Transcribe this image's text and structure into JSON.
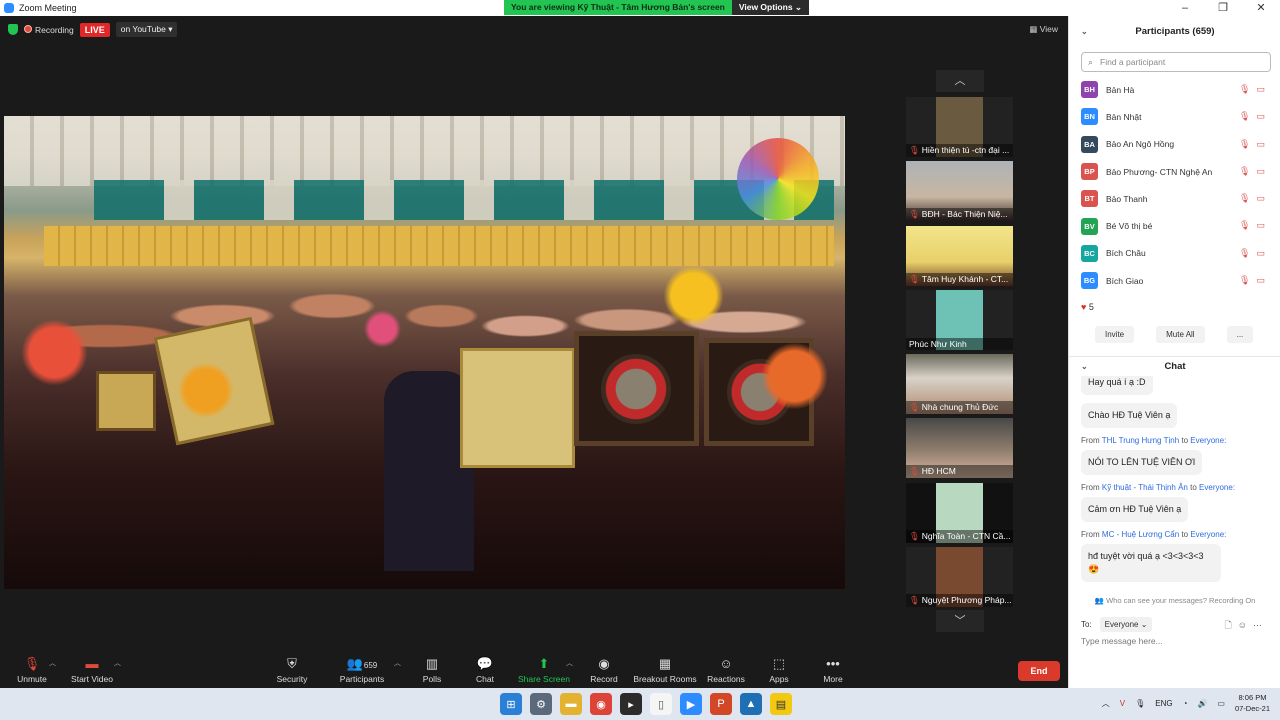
{
  "window": {
    "title": "Zoom Meeting"
  },
  "banner": {
    "text": "You are viewing Kỹ Thuật - Tâm Hương Bản's screen",
    "options_label": "View Options ⌄"
  },
  "status": {
    "recording_label": "Recording",
    "live_label": "LIVE",
    "stream_target": "on YouTube ▾",
    "view_label": "View"
  },
  "thumbnails": [
    "Hiền thiện tú -ctn đại ...",
    "BĐH - Bác Thiện Niệ...",
    "Tâm Huy Khánh - CT...",
    "Phúc Như Kinh",
    "Nhà chung Thủ Đức",
    "HĐ HCM",
    "Nghĩa Toàn - CTN Cầ...",
    "Nguyệt Phương Pháp..."
  ],
  "toolbar": {
    "unmute": "Unmute",
    "start_video": "Start Video",
    "security": "Security",
    "participants": "Participants",
    "participants_count": "659",
    "polls": "Polls",
    "chat": "Chat",
    "share_screen": "Share Screen",
    "record": "Record",
    "breakout": "Breakout Rooms",
    "reactions": "Reactions",
    "apps": "Apps",
    "more": "More",
    "end": "End"
  },
  "participants_panel": {
    "title": "Participants (659)",
    "search_placeholder": "Find a participant",
    "items": [
      {
        "initials": "BH",
        "name": "Bản Hà",
        "color": "#8e44ad"
      },
      {
        "initials": "BN",
        "name": "Bản Nhật",
        "color": "#2d8cff"
      },
      {
        "initials": "BA",
        "name": "Bảo An Ngô Hồng",
        "color": "#34495e"
      },
      {
        "initials": "BP",
        "name": "Bảo Phương- CTN Nghệ An",
        "color": "#d9534f"
      },
      {
        "initials": "BT",
        "name": "Bảo Thanh",
        "color": "#d9534f"
      },
      {
        "initials": "BV",
        "name": "Bé Võ thị bé",
        "color": "#23a455"
      },
      {
        "initials": "BC",
        "name": "Bích Châu",
        "color": "#16a6a0"
      },
      {
        "initials": "BG",
        "name": "Bích Giao",
        "color": "#2d8cff"
      }
    ],
    "reaction_count": "5",
    "invite": "Invite",
    "mute_all": "Mute All",
    "more": "..."
  },
  "chat_panel": {
    "title": "Chat",
    "messages": [
      {
        "from": "",
        "to": "",
        "text": "Hay quá í ạ :D"
      },
      {
        "from": "",
        "to": "",
        "text": "Chào HĐ Tuệ Viên ạ"
      },
      {
        "from": "THL Trung Hưng Tịnh",
        "to": "Everyone:",
        "text": "NÓI TO LÊN TUỆ VIÊN ƠI"
      },
      {
        "from": "Kỹ thuật - Thái Thịnh Ân",
        "to": "Everyone:",
        "text": "Cảm ơn HĐ Tuệ Viên ạ"
      },
      {
        "from": "MC - Huệ Lương Cẩn",
        "to": "Everyone:",
        "text": "hđ tuyệt vời quá ạ <3<3<3<3 😍"
      }
    ],
    "from_prefix": "From",
    "to_word": "to",
    "note": "Who can see your messages? Recording On",
    "to_label": "To:",
    "to_value": "Everyone ⌄",
    "input_placeholder": "Type message here..."
  },
  "taskbar": {
    "lang": "ENG",
    "time": "8:06 PM",
    "date": "07-Dec-21"
  }
}
